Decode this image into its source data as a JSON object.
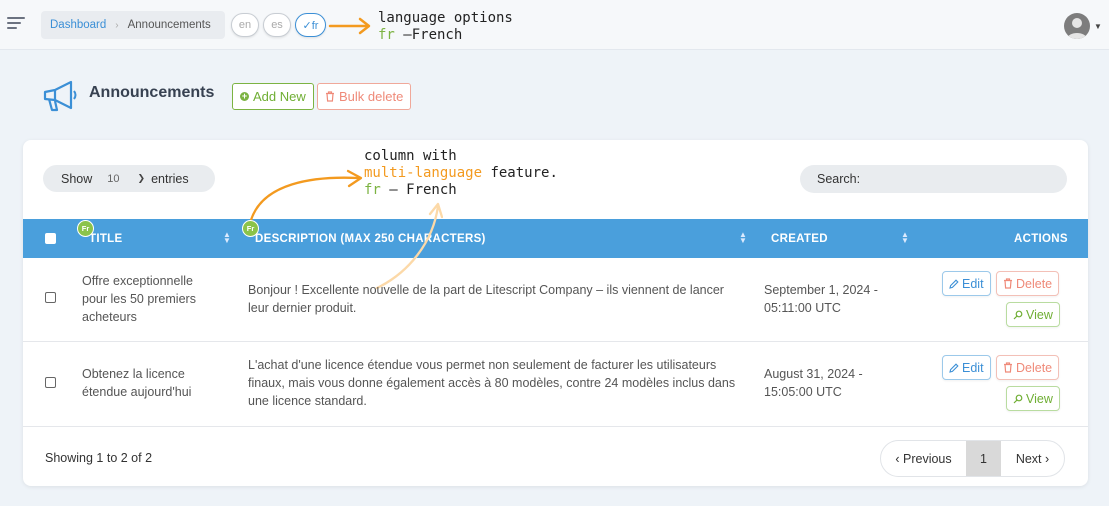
{
  "breadcrumb": {
    "home": "Dashboard",
    "current": "Announcements"
  },
  "languages": [
    {
      "code": "en",
      "label": "en"
    },
    {
      "code": "es",
      "label": "es"
    },
    {
      "code": "fr",
      "label": "✓fr"
    }
  ],
  "annotations": {
    "lang_line1": "language options",
    "lang_code": "fr",
    "lang_name": " –French",
    "col_line1": "column with",
    "col_hl": "multi-language",
    "col_rest": " feature.",
    "col_code": "fr",
    "col_name": " – French"
  },
  "page": {
    "title": "Announcements",
    "add_label": "Add New",
    "bulk_label": "Bulk delete"
  },
  "table_controls": {
    "show_label": "Show",
    "entries_value": "10",
    "entries_label": "entries",
    "search_label": "Search:",
    "search_value": ""
  },
  "columns": {
    "title": "TITLE",
    "description": "DESCRIPTION (MAX 250 CHARACTERS)",
    "created": "CREATED",
    "actions": "ACTIONS",
    "lang_badge": "Fr"
  },
  "rows": [
    {
      "title_l1": "Offre exceptionnelle",
      "title_l2": "pour les 50 premiers",
      "title_l3": "acheteurs",
      "desc_l1": "Bonjour ! Excellente nouvelle de la part de Litescript Company – ils viennent de lancer",
      "desc_l2": "leur dernier produit.",
      "created_l1": "September 1, 2024 -",
      "created_l2": "05:11:00 UTC"
    },
    {
      "title_l1": "Obtenez la licence",
      "title_l2": "étendue aujourd'hui",
      "desc_l1": "L'achat d'une licence étendue vous permet non seulement de facturer les utilisateurs",
      "desc_l2": "finaux, mais vous donne également accès à 80 modèles, contre 24 modèles inclus dans",
      "desc_l3": "une licence standard.",
      "created_l1": "August 31, 2024 -",
      "created_l2": "15:05:00 UTC"
    }
  ],
  "actions": {
    "edit": "Edit",
    "delete": "Delete",
    "view": "View"
  },
  "footer": {
    "showing": "Showing 1 to 2 of 2"
  },
  "pagination": {
    "prev": "‹ Previous",
    "page": "1",
    "next": "Next ›"
  },
  "colors": {
    "header_blue": "#4a9fdc",
    "accent_orange": "#f39a1f",
    "green": "#7cb342",
    "danger": "#ef8a79",
    "link_blue": "#3b8fd6"
  }
}
